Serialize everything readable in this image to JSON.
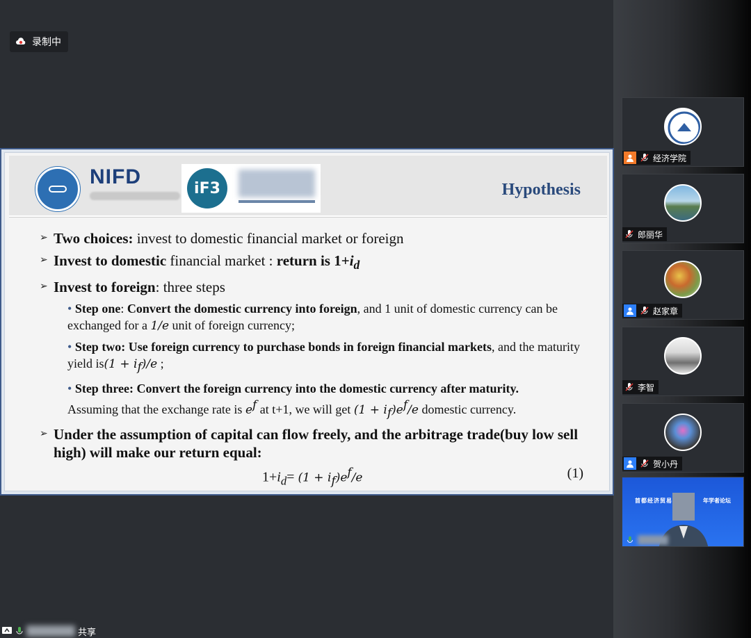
{
  "recording": {
    "label": "录制中"
  },
  "slide": {
    "logo_text": "NIFD",
    "ifb_label": "iF3",
    "title": "Hypothesis",
    "bullets": [
      {
        "bold": "Two choices:",
        "text": " invest to domestic financial market or foreign"
      },
      {
        "bold": "Invest to domestic",
        "text": " financial market : ",
        "bold2": "return is 1+",
        "math": "i",
        "sub": "d"
      },
      {
        "bold": "Invest to foreign",
        "text": ": three steps"
      }
    ],
    "steps": [
      {
        "bold": "Step one",
        "text1": ": ",
        "bold2": "Convert the domestic currency into foreign",
        "text2": ", and 1 unit of domestic currency can be exchanged for a ",
        "math": "1/e",
        "text3": "  unit of foreign currency;"
      },
      {
        "bold": "Step two: Use foreign currency to purchase bonds in foreign financial markets",
        "text1": ", and the maturity yield is",
        "math": "(1 + i",
        "sub": "f",
        "math2": ")/e",
        "text2": "  ;"
      },
      {
        "bold": "Step three: Convert the foreign currency into the domestic currency after maturity.",
        "text1": "Assuming that the exchange rate is ",
        "math": "e",
        "sup": "f",
        "text2": " at t+1, we will get ",
        "math2": "(1 + i",
        "sub": "f",
        "math3": ")e",
        "sup2": "f",
        "math4": "/e",
        "text3": " domestic currency."
      }
    ],
    "conclusion": "Under the assumption of capital can flow freely, and the arbitrage trade(buy low sell high) will make our return equal:",
    "equation": {
      "lhs": "1+",
      "i": "i",
      "d": "d",
      "eq": "= ",
      "rhs1": "(1 + i",
      "f": "f",
      "rhs2": ")e",
      "sup": "f",
      "rhs3": "/e",
      "number": "(1)"
    }
  },
  "participants": [
    {
      "name": "经济学院",
      "role": "host"
    },
    {
      "name": "郎丽华",
      "role": "member"
    },
    {
      "name": "赵家章",
      "role": "member"
    },
    {
      "name": "李智",
      "role": "member"
    },
    {
      "name": "贺小丹",
      "role": "member"
    }
  ],
  "video": {
    "banner_left": "首都经济贸易",
    "banner_right": "年学者论坛"
  },
  "bottom": {
    "share_label": "共享"
  }
}
